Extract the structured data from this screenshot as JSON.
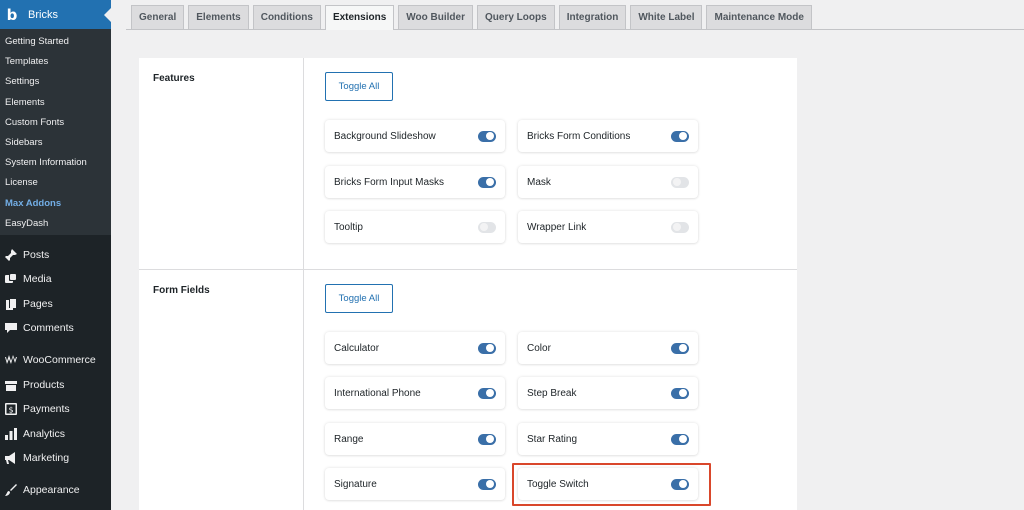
{
  "sidebar": {
    "brand_label": "Bricks",
    "submenu": [
      "Getting Started",
      "Templates",
      "Settings",
      "Elements",
      "Custom Fonts",
      "Sidebars",
      "System Information",
      "License",
      "Max Addons",
      "EasyDash"
    ],
    "active_submenu": "Max Addons",
    "menu": [
      {
        "label": "Posts",
        "icon": "pin-icon"
      },
      {
        "label": "Media",
        "icon": "media-icon"
      },
      {
        "label": "Pages",
        "icon": "pages-icon"
      },
      {
        "label": "Comments",
        "icon": "comments-icon"
      },
      {
        "label": "WooCommerce",
        "icon": "woocommerce-icon"
      },
      {
        "label": "Products",
        "icon": "products-icon"
      },
      {
        "label": "Payments",
        "icon": "payments-icon"
      },
      {
        "label": "Analytics",
        "icon": "analytics-icon"
      },
      {
        "label": "Marketing",
        "icon": "marketing-icon"
      },
      {
        "label": "Appearance",
        "icon": "appearance-icon"
      }
    ]
  },
  "tabs": [
    "General",
    "Elements",
    "Conditions",
    "Extensions",
    "Woo Builder",
    "Query Loops",
    "Integration",
    "White Label",
    "Maintenance Mode"
  ],
  "active_tab": "Extensions",
  "sections": [
    {
      "title": "Features",
      "toggle_all_label": "Toggle All",
      "items": [
        {
          "label": "Background Slideshow",
          "enabled": true
        },
        {
          "label": "Bricks Form Conditions",
          "enabled": true
        },
        {
          "label": "Bricks Form Input Masks",
          "enabled": true
        },
        {
          "label": "Mask",
          "enabled": false
        },
        {
          "label": "Tooltip",
          "enabled": false
        },
        {
          "label": "Wrapper Link",
          "enabled": false
        }
      ]
    },
    {
      "title": "Form Fields",
      "toggle_all_label": "Toggle All",
      "items": [
        {
          "label": "Calculator",
          "enabled": true
        },
        {
          "label": "Color",
          "enabled": true
        },
        {
          "label": "International Phone",
          "enabled": true
        },
        {
          "label": "Step Break",
          "enabled": true
        },
        {
          "label": "Range",
          "enabled": true
        },
        {
          "label": "Star Rating",
          "enabled": true
        },
        {
          "label": "Signature",
          "enabled": true
        },
        {
          "label": "Toggle Switch",
          "enabled": true
        }
      ]
    }
  ],
  "colors": {
    "accent": "#2271b1",
    "toggle_on": "#3a6fa8",
    "highlight": "#d9472b",
    "sidebar_bg": "#1d2327"
  }
}
